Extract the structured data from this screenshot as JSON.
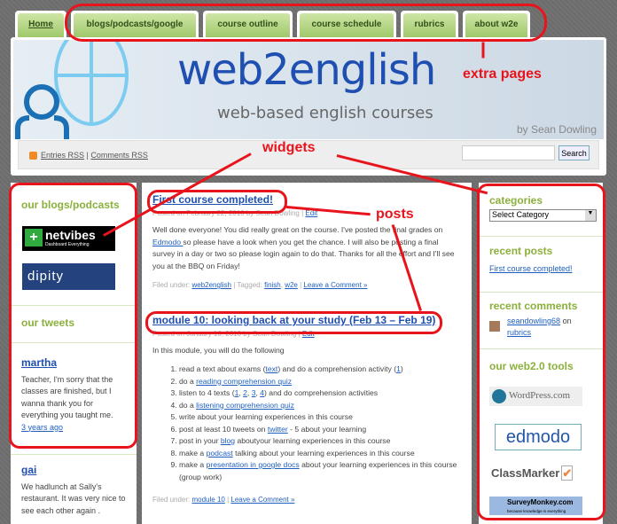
{
  "nav": {
    "tabs": [
      "Home",
      "blogs/podcasts/google",
      "course outline",
      "course schedule",
      "rubrics",
      "about w2e"
    ]
  },
  "header": {
    "title": "web2english",
    "tagline": "web-based english courses",
    "byline": "by Sean Dowling",
    "entries_rss": "Entries RSS",
    "separator": "|",
    "comments_rss": "Comments RSS",
    "search_placeholder": "",
    "search_button": "Search"
  },
  "annotations": {
    "extra_pages": "extra pages",
    "widgets": "widgets",
    "posts": "posts"
  },
  "left_sidebar": {
    "blogs_title": "our blogs/podcasts",
    "logos": [
      "netvibes",
      "dipity"
    ],
    "netvibes_tagline": "Dashboard Everything",
    "tweets_title": "our tweets",
    "tweets": [
      {
        "user": "martha",
        "text": "Teacher, I'm sorry that the classes are finished, but I wanna thank you for everything you taught me.",
        "time": "3 years ago"
      },
      {
        "user": "gai",
        "text": "We hadlunch at Sally's restaurant. It was very nice to see each other again ."
      }
    ]
  },
  "posts": [
    {
      "title": "First course completed!",
      "meta": "Posted on February 22, 2010 by Sean Dowling",
      "edit": "Edit",
      "body_pre": "Well done everyone! You did really great on the course. I've posted the final grades on ",
      "body_link": "Edmodo ",
      "body_post": "so please have a look when you get the chance. I will also be posting a final survey in a day or two so please login again to do that. Thanks for all the effort and I'll see you at the BBQ on Friday!",
      "filed_label": "Filed under:",
      "category": "web2english",
      "tagged_label": "| Tagged:",
      "tags": [
        "finish",
        "w2e"
      ],
      "comment": "Leave a Comment »"
    },
    {
      "title": "module 10: looking back at your study (Feb 13 – Feb 19)",
      "meta": "Posted on January 16, 2010 by Sean Dowling",
      "edit": "Edit",
      "intro": "In this module, you will do the following",
      "items": [
        [
          {
            "t": "read a text about exams ("
          },
          {
            "l": "text"
          },
          {
            "t": ") and do a comprehension activity ("
          },
          {
            "l": "1"
          },
          {
            "t": ")"
          }
        ],
        [
          {
            "t": "do a "
          },
          {
            "l": "reading comprehension quiz"
          }
        ],
        [
          {
            "t": "listen to 4 texts ("
          },
          {
            "l": "1"
          },
          {
            "t": ", "
          },
          {
            "l": "2"
          },
          {
            "t": ", "
          },
          {
            "l": "3"
          },
          {
            "t": ", "
          },
          {
            "l": "4"
          },
          {
            "t": ") and do comprehension activities"
          }
        ],
        [
          {
            "t": "do a "
          },
          {
            "l": "listening comprehension quiz"
          }
        ],
        [
          {
            "t": "write about your learning experiences in this course"
          }
        ],
        [
          {
            "t": "post at least 10 tweets on "
          },
          {
            "l": "twitter"
          },
          {
            "t": " - 5 about your learning"
          }
        ],
        [
          {
            "t": "post in your "
          },
          {
            "l": "blog"
          },
          {
            "t": " aboutyour learning experiences in this course"
          }
        ],
        [
          {
            "t": "make a "
          },
          {
            "l": "podcast"
          },
          {
            "t": " talking about your learning experiences in this course"
          }
        ],
        [
          {
            "t": "make a "
          },
          {
            "l": "presentation in google docs"
          },
          {
            "t": " about your learning experiences in this course (group work)"
          }
        ]
      ],
      "filed_label": "Filed under:",
      "category": "module 10",
      "comment": "Leave a Comment »"
    }
  ],
  "right_sidebar": {
    "categories_title": "categories",
    "category_select": "Select Category",
    "recent_posts_title": "recent posts",
    "recent_posts": [
      "First course completed!"
    ],
    "recent_comments_title": "recent comments",
    "comment_author": "seandowling68",
    "comment_on": "on",
    "comment_post": "rubrics",
    "tools_title": "our web2.0 tools",
    "tools": [
      "WordPress.com",
      "edmodo",
      "ClassMarker",
      "SurveyMonkey.com"
    ],
    "surveymonkey_tagline": "because knowledge is everything"
  },
  "colors": {
    "annotation": "#e8141c",
    "tab_green": "#9fc86a",
    "widget_title": "#8bb03c",
    "link": "#1f5fbf",
    "title_blue": "#1f4fb0"
  }
}
